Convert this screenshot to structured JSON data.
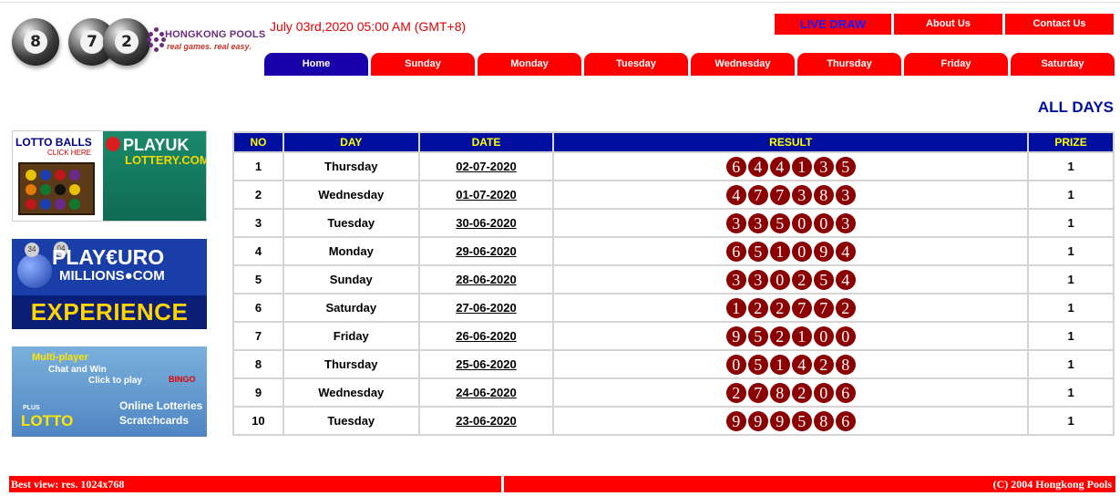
{
  "logo": {
    "balls": [
      "8",
      "7",
      "2"
    ],
    "brand_name": "HONGKONG POOLS",
    "brand_tagline": "real games. real easy."
  },
  "datetime": "July 03rd,2020 05:00 AM (GMT+8)",
  "top_links": {
    "live_draw": "LIVE DRAW",
    "about": "About Us",
    "contact": "Contact Us"
  },
  "nav": {
    "tabs": [
      "Home",
      "Sunday",
      "Monday",
      "Tuesday",
      "Wednesday",
      "Thursday",
      "Friday",
      "Saturday"
    ],
    "active": "Home"
  },
  "page_heading": "ALL DAYS",
  "banners": {
    "lotto_balls": {
      "title": "LOTTO BALLS",
      "click": "CLICK HERE",
      "play": "PLAYUK",
      "lottery": "LOTTERY.COM"
    },
    "euromillions": {
      "play": "PLAY€URO",
      "millions": "MILLIONS●COM",
      "experience": "EXPERIENCE",
      "ball_left": "34",
      "ball_right": "04"
    },
    "plus_lotto": {
      "multi": "Multi-player",
      "chat": "Chat and Win",
      "click": "Click to play",
      "bingo": "BINGO",
      "online": "Online Lotteries",
      "scratch": "Scratchcards",
      "lotto": "LOTTO",
      "plus": "PLUS"
    }
  },
  "table": {
    "headers": {
      "no": "NO",
      "day": "DAY",
      "date": "DATE",
      "result": "RESULT",
      "prize": "PRIZE"
    },
    "rows": [
      {
        "no": "1",
        "day": "Thursday",
        "date": "02-07-2020",
        "result": [
          "6",
          "4",
          "4",
          "1",
          "3",
          "5"
        ],
        "prize": "1"
      },
      {
        "no": "2",
        "day": "Wednesday",
        "date": "01-07-2020",
        "result": [
          "4",
          "7",
          "7",
          "3",
          "8",
          "3"
        ],
        "prize": "1"
      },
      {
        "no": "3",
        "day": "Tuesday",
        "date": "30-06-2020",
        "result": [
          "3",
          "3",
          "5",
          "0",
          "0",
          "3"
        ],
        "prize": "1"
      },
      {
        "no": "4",
        "day": "Monday",
        "date": "29-06-2020",
        "result": [
          "6",
          "5",
          "1",
          "0",
          "9",
          "4"
        ],
        "prize": "1"
      },
      {
        "no": "5",
        "day": "Sunday",
        "date": "28-06-2020",
        "result": [
          "3",
          "3",
          "0",
          "2",
          "5",
          "4"
        ],
        "prize": "1"
      },
      {
        "no": "6",
        "day": "Saturday",
        "date": "27-06-2020",
        "result": [
          "1",
          "2",
          "2",
          "7",
          "7",
          "2"
        ],
        "prize": "1"
      },
      {
        "no": "7",
        "day": "Friday",
        "date": "26-06-2020",
        "result": [
          "9",
          "5",
          "2",
          "1",
          "0",
          "0"
        ],
        "prize": "1"
      },
      {
        "no": "8",
        "day": "Thursday",
        "date": "25-06-2020",
        "result": [
          "0",
          "5",
          "1",
          "4",
          "2",
          "8"
        ],
        "prize": "1"
      },
      {
        "no": "9",
        "day": "Wednesday",
        "date": "24-06-2020",
        "result": [
          "2",
          "7",
          "8",
          "2",
          "0",
          "6"
        ],
        "prize": "1"
      },
      {
        "no": "10",
        "day": "Tuesday",
        "date": "23-06-2020",
        "result": [
          "9",
          "9",
          "9",
          "5",
          "8",
          "6"
        ],
        "prize": "1"
      }
    ]
  },
  "footer": {
    "left": "Best view: res. 1024x768",
    "right": "(C) 2004 Hongkong Pools"
  },
  "colors": {
    "red": "#ff0000",
    "navy": "#000f9f",
    "header_text": "#ffff00",
    "ball": "#8b0000",
    "active_tab": "#1a00a8"
  }
}
